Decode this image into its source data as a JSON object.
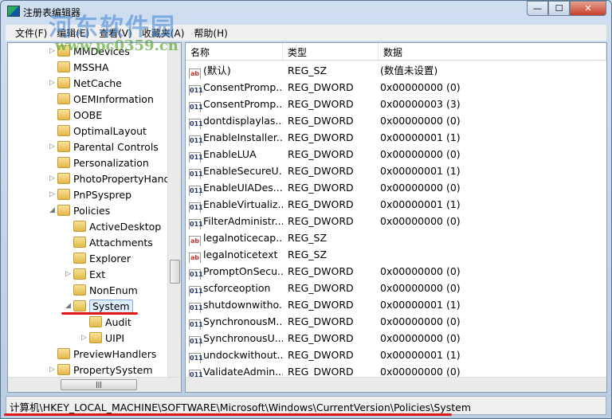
{
  "window": {
    "title": "注册表编辑器",
    "min": "—",
    "max": "☐",
    "close": "✕"
  },
  "menu": [
    "文件(F)",
    "编辑(E)",
    "查看(V)",
    "收藏夹(A)",
    "帮助(H)"
  ],
  "watermark": {
    "name": "河东软件园",
    "url": "www.pc0359.cn"
  },
  "tree": [
    {
      "label": "MMDevices",
      "exp": "▷",
      "lvl": 0
    },
    {
      "label": "MSSHA",
      "exp": "",
      "lvl": 0
    },
    {
      "label": "NetCache",
      "exp": "▷",
      "lvl": 0
    },
    {
      "label": "OEMInformation",
      "exp": "",
      "lvl": 0
    },
    {
      "label": "OOBE",
      "exp": "",
      "lvl": 0
    },
    {
      "label": "OptimalLayout",
      "exp": "",
      "lvl": 0
    },
    {
      "label": "Parental Controls",
      "exp": "▷",
      "lvl": 0
    },
    {
      "label": "Personalization",
      "exp": "",
      "lvl": 0
    },
    {
      "label": "PhotoPropertyHand",
      "exp": "▷",
      "lvl": 0
    },
    {
      "label": "PnPSysprep",
      "exp": "▷",
      "lvl": 0
    },
    {
      "label": "Policies",
      "exp": "◢",
      "lvl": 0
    },
    {
      "label": "ActiveDesktop",
      "exp": "",
      "lvl": 1
    },
    {
      "label": "Attachments",
      "exp": "",
      "lvl": 1
    },
    {
      "label": "Explorer",
      "exp": "",
      "lvl": 1
    },
    {
      "label": "Ext",
      "exp": "▷",
      "lvl": 1
    },
    {
      "label": "NonEnum",
      "exp": "",
      "lvl": 1
    },
    {
      "label": "System",
      "exp": "◢",
      "lvl": 1,
      "selected": true
    },
    {
      "label": "Audit",
      "exp": "",
      "lvl": 2
    },
    {
      "label": "UIPI",
      "exp": "▷",
      "lvl": 2
    },
    {
      "label": "PreviewHandlers",
      "exp": "",
      "lvl": 0
    },
    {
      "label": "PropertySystem",
      "exp": "▷",
      "lvl": 0
    }
  ],
  "columns": [
    "名称",
    "类型",
    "数据"
  ],
  "values": [
    {
      "icon": "ab",
      "name": "(默认)",
      "type": "REG_SZ",
      "data": "(数值未设置)"
    },
    {
      "icon": "bin",
      "name": "ConsentPromp...",
      "type": "REG_DWORD",
      "data": "0x00000000 (0)"
    },
    {
      "icon": "bin",
      "name": "ConsentPromp...",
      "type": "REG_DWORD",
      "data": "0x00000003 (3)"
    },
    {
      "icon": "bin",
      "name": "dontdisplaylas...",
      "type": "REG_DWORD",
      "data": "0x00000000 (0)"
    },
    {
      "icon": "bin",
      "name": "EnableInstaller...",
      "type": "REG_DWORD",
      "data": "0x00000001 (1)"
    },
    {
      "icon": "bin",
      "name": "EnableLUA",
      "type": "REG_DWORD",
      "data": "0x00000000 (0)"
    },
    {
      "icon": "bin",
      "name": "EnableSecureU...",
      "type": "REG_DWORD",
      "data": "0x00000001 (1)"
    },
    {
      "icon": "bin",
      "name": "EnableUIADes...",
      "type": "REG_DWORD",
      "data": "0x00000000 (0)"
    },
    {
      "icon": "bin",
      "name": "EnableVirtualiz...",
      "type": "REG_DWORD",
      "data": "0x00000001 (1)"
    },
    {
      "icon": "bin",
      "name": "FilterAdministr...",
      "type": "REG_DWORD",
      "data": "0x00000000 (0)"
    },
    {
      "icon": "ab",
      "name": "legalnoticecap...",
      "type": "REG_SZ",
      "data": ""
    },
    {
      "icon": "ab",
      "name": "legalnoticetext",
      "type": "REG_SZ",
      "data": ""
    },
    {
      "icon": "bin",
      "name": "PromptOnSecu...",
      "type": "REG_DWORD",
      "data": "0x00000000 (0)"
    },
    {
      "icon": "bin",
      "name": "scforceoption",
      "type": "REG_DWORD",
      "data": "0x00000000 (0)"
    },
    {
      "icon": "bin",
      "name": "shutdownwitho...",
      "type": "REG_DWORD",
      "data": "0x00000001 (1)"
    },
    {
      "icon": "bin",
      "name": "SynchronousM...",
      "type": "REG_DWORD",
      "data": "0x00000000 (0)"
    },
    {
      "icon": "bin",
      "name": "SynchronousU...",
      "type": "REG_DWORD",
      "data": "0x00000000 (0)"
    },
    {
      "icon": "bin",
      "name": "undockwithout...",
      "type": "REG_DWORD",
      "data": "0x00000001 (1)"
    },
    {
      "icon": "bin",
      "name": "ValidateAdmin...",
      "type": "REG_DWORD",
      "data": "0x00000000 (0)"
    }
  ],
  "status": "计算机\\HKEY_LOCAL_MACHINE\\SOFTWARE\\Microsoft\\Windows\\CurrentVersion\\Policies\\System",
  "accent": "#e01818"
}
